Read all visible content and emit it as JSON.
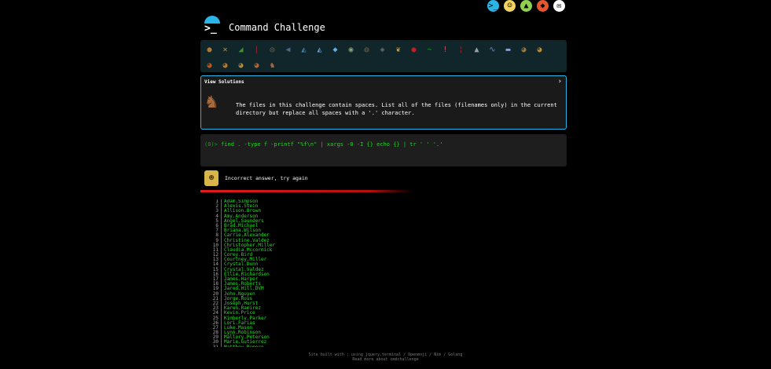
{
  "header": {
    "title": "Command Challenge",
    "prompt_glyph": ">_"
  },
  "top_icons": [
    {
      "name": "terminal-icon",
      "glyph": ">_",
      "color": "#2ab5e8"
    },
    {
      "name": "face-icon",
      "glyph": "☺",
      "color": "#f4d35e"
    },
    {
      "name": "tree-icon",
      "glyph": "▲",
      "color": "#8fd14f"
    },
    {
      "name": "fox-icon",
      "glyph": "◆",
      "color": "#e2552d"
    },
    {
      "name": "mail-icon",
      "glyph": "✉",
      "color": "#ffffff"
    }
  ],
  "challenge_icons_row1": [
    {
      "glyph": "●",
      "color": "#b07a36"
    },
    {
      "glyph": "✕",
      "color": "#c7932a"
    },
    {
      "glyph": "◢",
      "color": "#3b9a2a"
    },
    {
      "glyph": "|",
      "color": "#9a2a2a"
    },
    {
      "glyph": "◎",
      "color": "#7a6a5a"
    },
    {
      "glyph": "◀",
      "color": "#4b6a8a"
    },
    {
      "glyph": "◭",
      "color": "#4a8ab0"
    },
    {
      "glyph": "◭",
      "color": "#6aa0d0"
    },
    {
      "glyph": "◆",
      "color": "#60b0e0"
    },
    {
      "glyph": "◉",
      "color": "#8aa070"
    },
    {
      "glyph": "◍",
      "color": "#6a5a40"
    },
    {
      "glyph": "◈",
      "color": "#6a6a6a"
    },
    {
      "glyph": "❦",
      "color": "#d0a030"
    },
    {
      "glyph": "●",
      "color": "#c02020"
    },
    {
      "glyph": "~",
      "color": "#20a020"
    },
    {
      "glyph": "!",
      "color": "#cc5555"
    },
    {
      "glyph": "¦",
      "color": "#a03030"
    },
    {
      "glyph": "▲",
      "color": "#a0a0a0"
    },
    {
      "glyph": "∿",
      "color": "#6a8ab0"
    },
    {
      "glyph": "▬",
      "color": "#8aa0d0"
    },
    {
      "glyph": "◕",
      "color": "#a07a3a"
    },
    {
      "glyph": "◕",
      "color": "#c08a3a"
    }
  ],
  "challenge_icons_row2": [
    {
      "glyph": "◕",
      "color": "#c05a20"
    },
    {
      "glyph": "◕",
      "color": "#c07a30"
    },
    {
      "glyph": "◕",
      "color": "#b08a40"
    },
    {
      "glyph": "◕",
      "color": "#b06a3a"
    },
    {
      "glyph": "♞",
      "color": "#a86a3a"
    }
  ],
  "card": {
    "view_solutions": "View Solutions",
    "chevron": "›",
    "description": "The files in this challenge contain spaces. List all of the files (filenames only) in the current directory but replace all spaces with a '.' character."
  },
  "command": {
    "prefix": "(0)>",
    "text": " find . -type f -printf \"%f\\n\" | xargs -0 -I {} echo {} | tr ' ' '.'"
  },
  "result": {
    "message": "Incorrect answer, try again"
  },
  "output": [
    {
      "n": "1",
      "name": "Adam.Simpson"
    },
    {
      "n": "2",
      "name": "Alexis.Stein"
    },
    {
      "n": "3",
      "name": "Allison.Brown"
    },
    {
      "n": "4",
      "name": "Amy.Anderson"
    },
    {
      "n": "5",
      "name": "Angel.Saunders"
    },
    {
      "n": "6",
      "name": "Brad.Michael"
    },
    {
      "n": "7",
      "name": "Briana.Wilson"
    },
    {
      "n": "8",
      "name": "Carrie.Alexander"
    },
    {
      "n": "9",
      "name": "Christine.Valdez"
    },
    {
      "n": "10",
      "name": "Christopher.Miller"
    },
    {
      "n": "11",
      "name": "Claudia.Mccormick"
    },
    {
      "n": "12",
      "name": "Corey.Bird"
    },
    {
      "n": "13",
      "name": "Courtney.Miller"
    },
    {
      "n": "14",
      "name": "Crystal.Dunn"
    },
    {
      "n": "15",
      "name": "Crystal.Valdez"
    },
    {
      "n": "16",
      "name": "Ellie.Richardson"
    },
    {
      "n": "17",
      "name": "James.Harper"
    },
    {
      "n": "18",
      "name": "James.Roberts"
    },
    {
      "n": "19",
      "name": "Jared.Hill.DVM"
    },
    {
      "n": "20",
      "name": "John.Nguyen"
    },
    {
      "n": "21",
      "name": "Jorge.Ross"
    },
    {
      "n": "22",
      "name": "Joseph.Hurst"
    },
    {
      "n": "23",
      "name": "Karen.Ramirez"
    },
    {
      "n": "24",
      "name": "Kevin.Price"
    },
    {
      "n": "25",
      "name": "Kimberly.Parker"
    },
    {
      "n": "26",
      "name": "Lori.Farias"
    },
    {
      "n": "27",
      "name": "Luke.Mason"
    },
    {
      "n": "28",
      "name": "Lynn.Robinson"
    },
    {
      "n": "29",
      "name": "Mallory.Peterson"
    },
    {
      "n": "30",
      "name": "Marie.Gutierrez"
    },
    {
      "n": "31",
      "name": "Matthew.Romero"
    }
  ],
  "footer": {
    "line1": "Site built with : using jquery.terminal / Openmoji / Nim / Golang",
    "line2": "Read more about cmdchallenge"
  },
  "colors": {
    "accent": "#2ab5e8",
    "command": "#21d421",
    "error": "#e21b1b",
    "output": "#22e022"
  }
}
